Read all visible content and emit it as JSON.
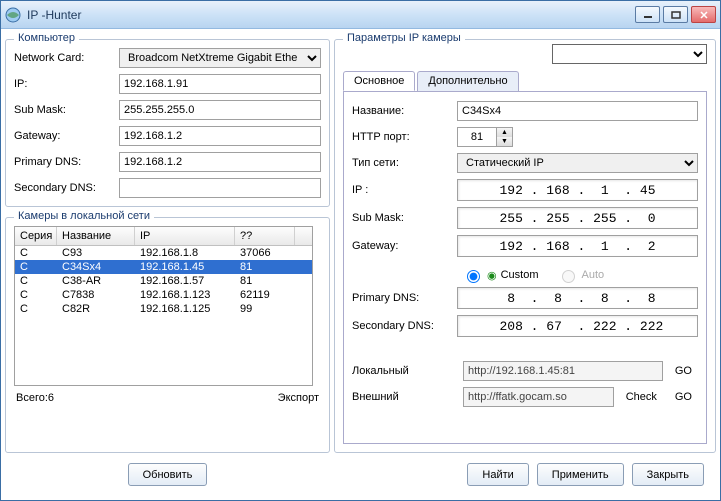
{
  "title": "IP  -Hunter",
  "computer": {
    "legend": "Компьютер",
    "rows": {
      "network_card": {
        "label": "Network Card:",
        "value": "Broadcom NetXtreme Gigabit Ethe"
      },
      "ip": {
        "label": "IP:",
        "value": "192.168.1.91"
      },
      "submask": {
        "label": "Sub Mask:",
        "value": "255.255.255.0"
      },
      "gateway": {
        "label": "Gateway:",
        "value": "192.168.1.2"
      },
      "primary_dns": {
        "label": "Primary DNS:",
        "value": "192.168.1.2"
      },
      "secondary_dns": {
        "label": "Secondary DNS:",
        "value": ""
      }
    }
  },
  "lan_cameras": {
    "legend": "Камеры в локальной сети",
    "columns": {
      "c1": "Серия",
      "c2": "Название",
      "c3": "IP",
      "c4": "??"
    },
    "rows": [
      {
        "series": "C",
        "name": "C93",
        "ip": "192.168.1.8",
        "port": "37066",
        "selected": false
      },
      {
        "series": "C",
        "name": "C34Sx4",
        "ip": "192.168.1.45",
        "port": "81",
        "selected": true
      },
      {
        "series": "C",
        "name": "C38-AR",
        "ip": "192.168.1.57",
        "port": "81",
        "selected": false
      },
      {
        "series": "C",
        "name": "C7838",
        "ip": "192.168.1.123",
        "port": "62119",
        "selected": false
      },
      {
        "series": "C",
        "name": "C82R",
        "ip": "192.168.1.125",
        "port": "99",
        "selected": false
      }
    ],
    "total": {
      "label": "Всего:6"
    },
    "export": "Экспорт",
    "refresh": "Обновить"
  },
  "camera_params": {
    "legend": "Параметры IP камеры",
    "selector_value": "",
    "tabs": {
      "main": "Основное",
      "extra": "Дополнительно"
    },
    "fields": {
      "name": {
        "label": "Название:",
        "value": "C34Sx4"
      },
      "http_port": {
        "label": "HTTP порт:",
        "value": "81"
      },
      "net_type": {
        "label": "Тип сети:",
        "value": "Статический IP"
      },
      "ip": {
        "label": "IP  :",
        "value": " 192 . 168 .  1  . 45 "
      },
      "submask": {
        "label": "Sub Mask:",
        "value": " 255 . 255 . 255 .  0 "
      },
      "gateway": {
        "label": "Gateway:",
        "value": " 192 . 168 .  1  .  2 "
      },
      "dns_mode": {
        "custom": "Custom",
        "auto": "Auto"
      },
      "primary_dns": {
        "label": "Primary DNS:",
        "value": "  8  .  8  .  8  .  8 "
      },
      "secondary_dns": {
        "label": "Secondary DNS:",
        "value": " 208 . 67  . 222 . 222"
      }
    },
    "links": {
      "local": {
        "label": "Локальный",
        "url": "http://192.168.1.45:81",
        "go": "GO"
      },
      "external": {
        "label": "Внешний",
        "url": "http://ffatk.gocam.so",
        "check": "Check",
        "go": "GO"
      }
    }
  },
  "buttons": {
    "find": "Найти",
    "apply": "Применить",
    "close": "Закрыть"
  }
}
